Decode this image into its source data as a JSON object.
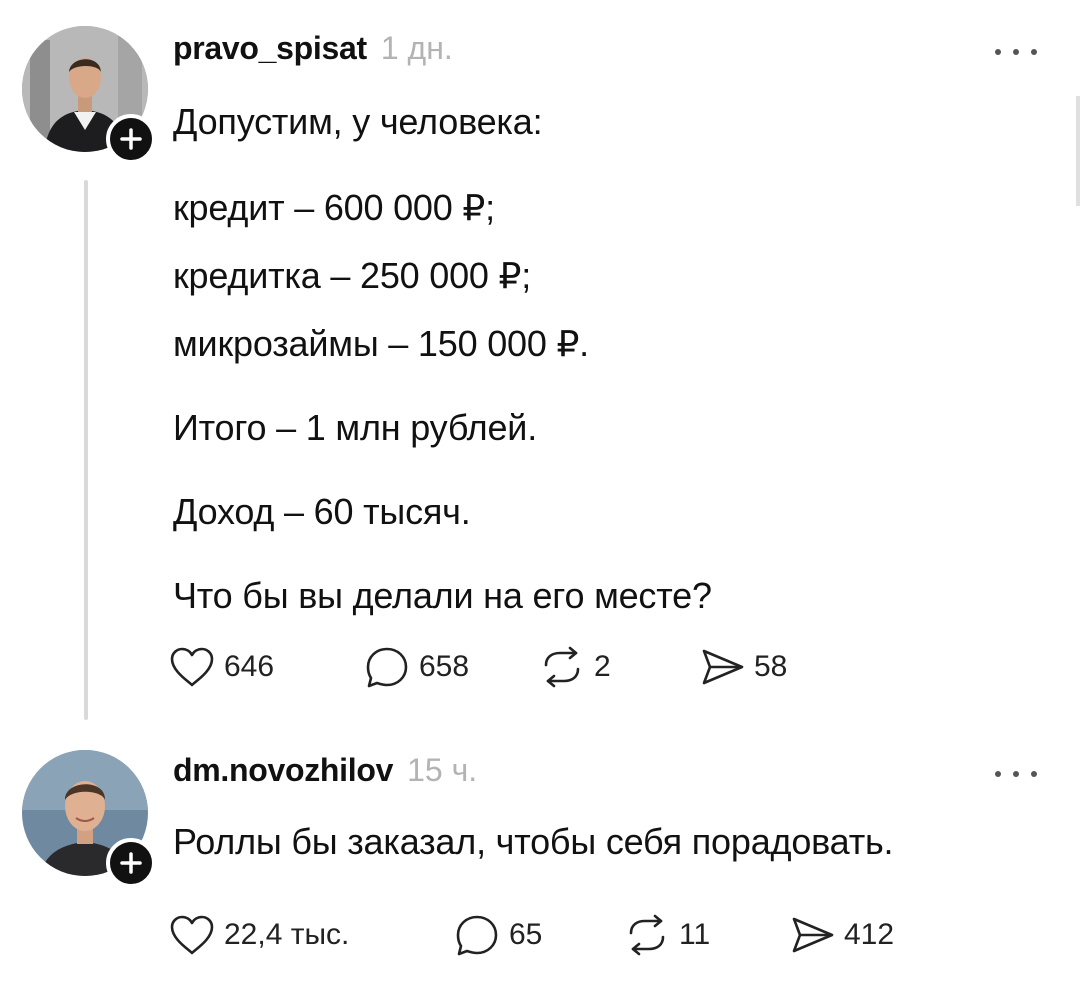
{
  "posts": [
    {
      "username": "pravo_spisat",
      "timestamp": "1 дн.",
      "paragraphs": [
        [
          "Допустим, у человека:"
        ],
        [
          "кредит – 600 000 ₽;",
          "кредитка – 250 000 ₽;",
          "микрозаймы – 150 000 ₽."
        ],
        [
          "Итого – 1 млн рублей."
        ],
        [
          "Доход – 60 тысяч."
        ],
        [
          "Что бы вы делали на его месте?"
        ]
      ],
      "stats": {
        "likes": "646",
        "replies": "658",
        "reposts": "2",
        "shares": "58"
      }
    },
    {
      "username": "dm.novozhilov",
      "timestamp": "15 ч.",
      "paragraphs": [
        [
          "Роллы бы заказал, чтобы себя порадовать."
        ]
      ],
      "stats": {
        "likes": "22,4 тыс.",
        "replies": "65",
        "reposts": "11",
        "shares": "412"
      }
    }
  ],
  "icons": {
    "follow": "plus-icon",
    "more": "more-dots-icon",
    "like": "heart-icon",
    "reply": "comment-bubble-icon",
    "repost": "repost-arrows-icon",
    "share": "send-icon"
  },
  "colors": {
    "text": "#111111",
    "muted": "#b3b3b3",
    "thread_line": "#d9d9d9",
    "badge": "#111111"
  }
}
